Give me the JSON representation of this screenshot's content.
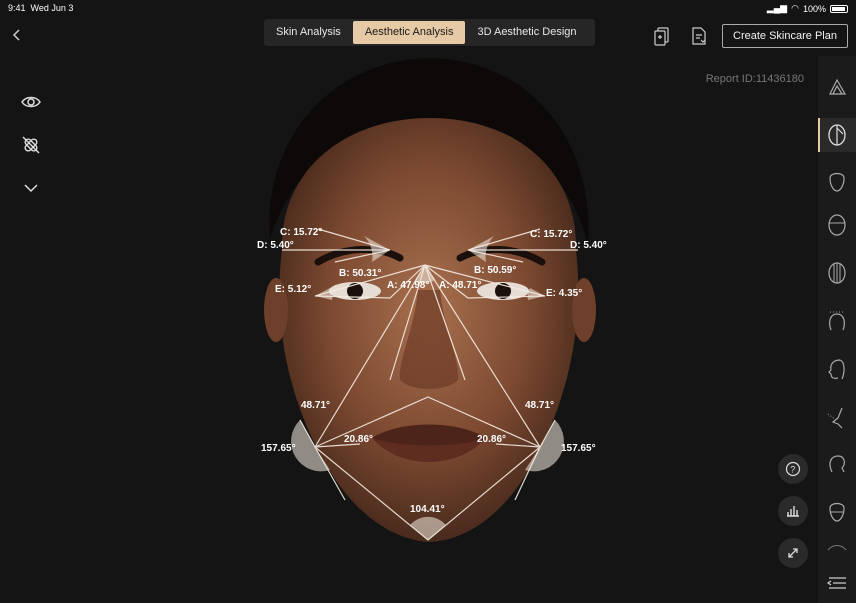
{
  "status": {
    "time": "9:41",
    "date": "Wed Jun 3",
    "battery": "100%"
  },
  "tabs": [
    {
      "label": "Skin Analysis",
      "active": false
    },
    {
      "label": "Aesthetic Analysis",
      "active": true
    },
    {
      "label": "3D Aesthetic Design",
      "active": false
    }
  ],
  "toolbar": {
    "create_label": "Create Skincare Plan"
  },
  "report": {
    "id_text": "Report ID:11436180"
  },
  "accent": "#e6c9a5",
  "angles": {
    "c_left": "C: 15.72°",
    "d_left": "D: 5.40°",
    "b_left": "B: 50.31°",
    "e_left": "E: 5.12°",
    "a_left": "A: 47.98°",
    "c_right": "C: 15.72°",
    "d_right": "D: 5.40°",
    "b_right": "B: 50.59°",
    "e_right": "E: 4.35°",
    "a_right": "A: 48.71°",
    "jaw_left_upper": "48.71°",
    "jaw_right_upper": "48.71°",
    "jaw_left": "157.65°",
    "jaw_right": "157.65°",
    "mouth_left": "20.86°",
    "mouth_right": "20.86°",
    "chin": "104.41°"
  },
  "icons": {
    "left_tools": [
      "eye-icon",
      "bandage-off-icon",
      "chevron-down-icon"
    ],
    "rail": [
      "face-contour-icon",
      "half-face-icon",
      "face-outline-icon",
      "face-ratio-icon",
      "face-grid-icon",
      "head-dotted-icon",
      "profile-icon",
      "nose-profile-icon",
      "head-side-icon",
      "chin-icon",
      "lips-icon",
      "collapse-menu-icon"
    ],
    "fabs": [
      "help-icon",
      "bar-chart-icon",
      "expand-icon"
    ]
  }
}
